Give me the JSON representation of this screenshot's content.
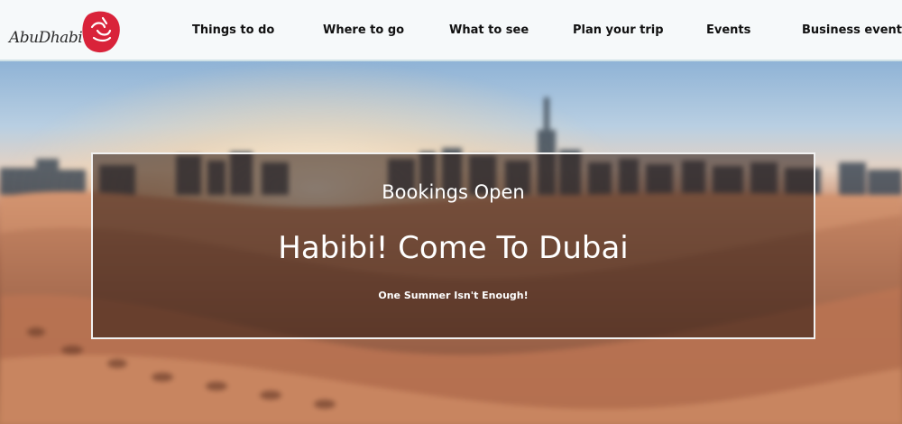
{
  "header": {
    "logo_text": "AbuDhabi",
    "nav": [
      {
        "label": "Things to do"
      },
      {
        "label": "Where to go"
      },
      {
        "label": "What to see"
      },
      {
        "label": "Plan your trip"
      },
      {
        "label": "Events"
      },
      {
        "label": "Business events"
      }
    ],
    "colors": {
      "logo_accent": "#d9233a",
      "nav_text": "#111111"
    }
  },
  "hero": {
    "kicker": "Bookings Open",
    "headline": "Habibi! Come To Dubai",
    "tagline": "One Summer Isn't Enough!"
  }
}
